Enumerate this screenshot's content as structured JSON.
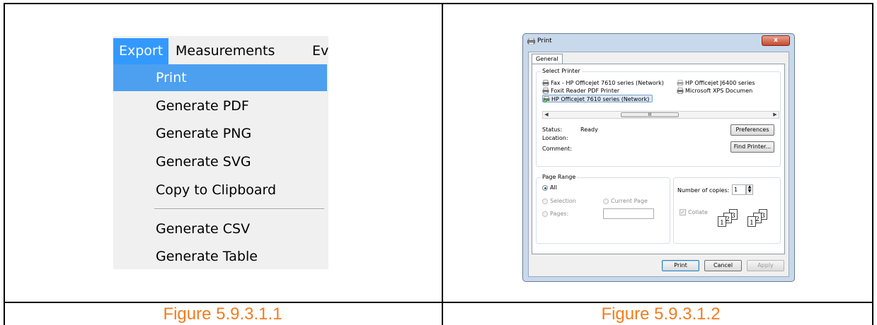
{
  "menu": {
    "bar": [
      "Export",
      "Measurements",
      "Ev"
    ],
    "items": [
      "Print",
      "Generate PDF",
      "Generate PNG",
      "Generate SVG",
      "Copy to Clipboard",
      "Generate CSV",
      "Generate Table"
    ],
    "highlighted": "Print"
  },
  "print_dialog": {
    "title": "Print",
    "close_glyph": "x",
    "tab": "General",
    "select_printer_label": "Select Printer",
    "printers": [
      "Fax - HP Officejet 7610 series (Network)",
      "HP Officejet J6400 series",
      "Foxit Reader PDF Printer",
      "Microsoft XPS Documen",
      "HP Officejet 7610 series (Network)"
    ],
    "selected_printer": "HP Officejet 7610 series (Network)",
    "scroll_thumb": "III",
    "status_label": "Status:",
    "status_value": "Ready",
    "location_label": "Location:",
    "comment_label": "Comment:",
    "preferences_button": "Preferences",
    "find_printer_button": "Find Printer...",
    "page_range_label": "Page Range",
    "range_all": "All",
    "range_selection": "Selection",
    "range_current_page": "Current Page",
    "range_pages": "Pages:",
    "copies_label": "Number of copies:",
    "copies_value": "1",
    "collate_label": "Collate",
    "print_button": "Print",
    "cancel_button": "Cancel",
    "apply_button": "Apply"
  },
  "captions": {
    "left": "Figure 5.9.3.1.1",
    "right": "Figure 5.9.3.1.2"
  },
  "colors": {
    "caption": "#f07d1e",
    "menu_highlight": "#4da0f0",
    "menubar_active": "#3399ff"
  }
}
